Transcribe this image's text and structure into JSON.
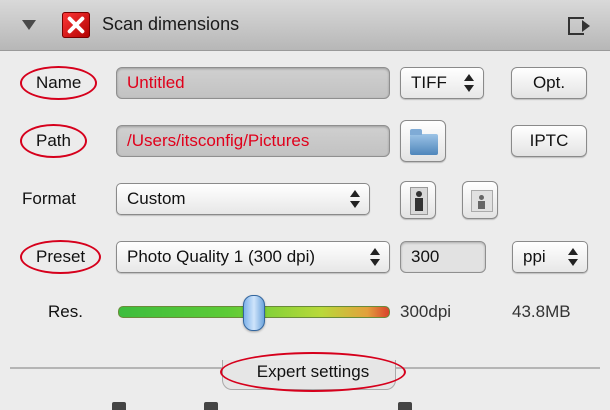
{
  "panel": {
    "title": "Scan dimensions",
    "icons": {
      "collapse": "disclosure-triangle-icon",
      "app": "scanner-app-icon",
      "detach": "detach-panel-icon"
    }
  },
  "name_row": {
    "label": "Name",
    "value": "Untitled",
    "format": "TIFF",
    "options_button": "Opt."
  },
  "path_row": {
    "label": "Path",
    "value": "/Users/itsconfig/Pictures",
    "iptc_button": "IPTC"
  },
  "format_row": {
    "label": "Format",
    "value": "Custom"
  },
  "preset_row": {
    "label": "Preset",
    "value": "Photo Quality 1 (300 dpi)",
    "resolution": "300",
    "unit": "ppi"
  },
  "res_row": {
    "label": "Res.",
    "dpi_text": "300dpi",
    "size_text": "43.8MB",
    "slider_level": 0.5
  },
  "expert": {
    "label": "Expert settings"
  },
  "colors": {
    "accent_red": "#e0001b",
    "annotation_red": "#d6001c"
  }
}
